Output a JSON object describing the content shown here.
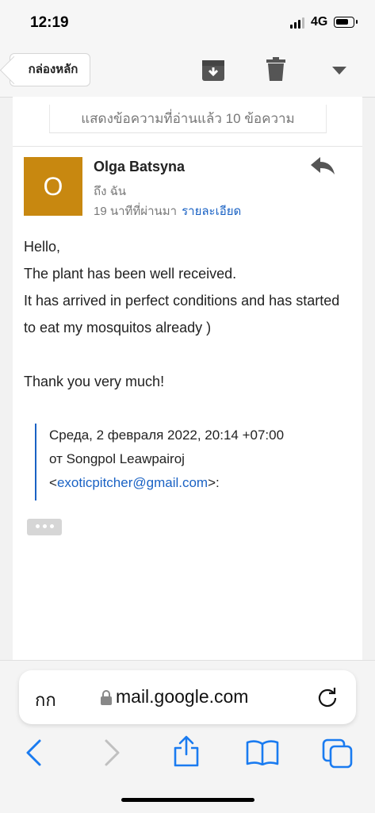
{
  "status": {
    "time": "12:19",
    "network": "4G"
  },
  "toolbar": {
    "back_label": "กล่องหลัก",
    "icons": [
      "archive-icon",
      "trash-icon",
      "dropdown-icon"
    ]
  },
  "thread": {
    "read_banner": "แสดงข้อความที่อ่านแล้ว 10 ข้อความ"
  },
  "message": {
    "avatar_letter": "O",
    "avatar_color": "#c88810",
    "sender": "Olga Batsyna",
    "to": "ถึง ฉัน",
    "time_ago": "19 นาทีที่ผ่านมา",
    "details_link": "รายละเอียด",
    "body": {
      "line1": "Hello,",
      "line2": "The plant has been well received.",
      "line3": "It has arrived in perfect conditions and has started to eat my mosquitos already )",
      "line4": "Thank you very much!"
    },
    "quote": {
      "header": "Среда, 2 февраля 2022, 20:14 +07:00",
      "from_prefix": "от Songpol Leawpairoj",
      "email_open": "<",
      "email": "exoticpitcher@gmail.com",
      "email_close": ">:"
    }
  },
  "browser": {
    "text_size_label": "กก",
    "url": "mail.google.com",
    "nav_icons": [
      "back-arrow-icon",
      "forward-arrow-icon",
      "share-icon",
      "bookmarks-icon",
      "tabs-icon"
    ]
  },
  "colors": {
    "link": "#1a62c4",
    "ios_blue": "#1a7bf0"
  }
}
